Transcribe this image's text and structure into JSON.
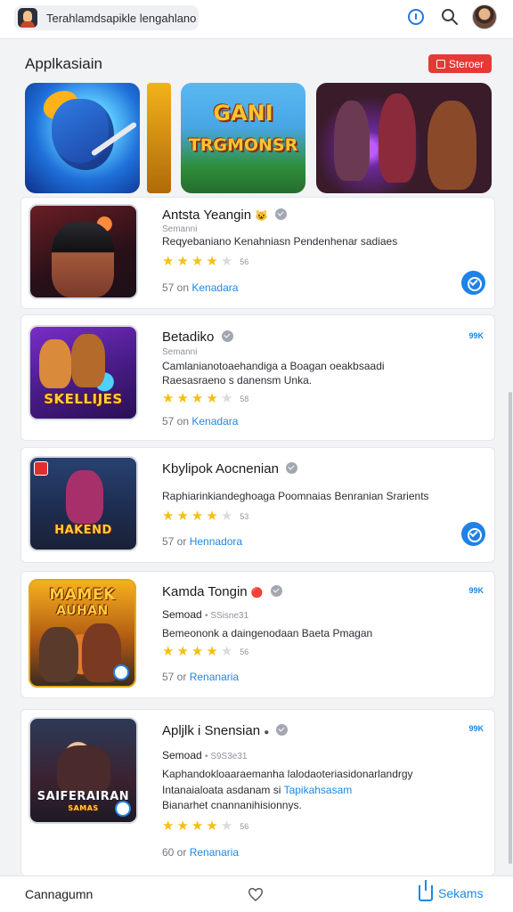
{
  "topbar": {
    "search_text": "Terahlamdsapikle lengahlano",
    "icons": [
      "app-icon",
      "info-icon",
      "search-icon",
      "avatar"
    ]
  },
  "section": {
    "title": "Applkasiain",
    "action_label": "Steroer",
    "accent": "#e53935"
  },
  "banners": [
    {
      "name": "banner-1",
      "title": ""
    },
    {
      "name": "banner-2",
      "title": ""
    },
    {
      "name": "banner-3",
      "title_line1": "GANI",
      "title_line2": "TRGMONSR"
    },
    {
      "name": "banner-4",
      "title": ""
    }
  ],
  "apps": [
    {
      "title": "Antsta Yeangin",
      "title_emoji": "😺",
      "subtitle": "Semanni",
      "desc_lines": [
        "Reqyebaniano Kenahniasn Pendenhenar sadiaes"
      ],
      "rating_stars": 4,
      "rating_text": "56",
      "meta": "57 on",
      "meta_link": "Kenadara",
      "count": "",
      "checked": true
    },
    {
      "title": "Betadiko",
      "title_emoji": "",
      "subtitle": "Semanni",
      "desc_lines": [
        "Camlanianotoaehandiga a Boagan oeakbsaadi",
        "Raesasraeno s danensm Unka."
      ],
      "rating_stars": 4,
      "rating_text": "58",
      "meta": "57 on",
      "meta_link": "Kenadara",
      "count": "99K",
      "checked": false,
      "thumb_label": "SKELLIJES"
    },
    {
      "title": "Kbylipok Aocnenian",
      "title_emoji": "",
      "subtitle": "",
      "desc_lines": [
        "Raphiarinkiandeghoaga Poomnaias Benranian Srarients"
      ],
      "rating_stars": 4,
      "rating_text": "53",
      "meta": "57 or",
      "meta_link": "Hennadora",
      "count": "",
      "checked": true,
      "thumb_label": "HAKEND"
    },
    {
      "title": "Kamda Tongin",
      "title_emoji": "🔴",
      "subtitle": "Semoad",
      "subtitle_extra": "• SSisne31",
      "desc_lines": [
        "Bemeononk a daingenodaan Baeta Pmagan"
      ],
      "rating_stars": 4,
      "rating_text": "56",
      "meta": "57 or",
      "meta_link": "Renanaria",
      "count": "99K",
      "checked": false,
      "thumb_label_top": "MAMEK",
      "thumb_label_bottom": "AUHAN"
    },
    {
      "title": "Apljlk i Snensian",
      "title_emoji": "●",
      "subtitle": "Semoad",
      "subtitle_extra": "• S9S3e31",
      "desc_lines": [
        "Kaphandokloaaraemanha lalodaoteriasidonarlandrgy",
        "Intanaialoata asdanam si",
        "Bianarhet cnannanihisionnys."
      ],
      "desc_link": "Tapikahsasam",
      "rating_stars": 4,
      "rating_text": "56",
      "meta": "60 or",
      "meta_link": "Renanaria",
      "count": "99K",
      "checked": false,
      "thumb_label": "SAIFERAIRAN",
      "thumb_sub": "SAMAS"
    }
  ],
  "bottom_nav": {
    "left_label": "Cannagumn",
    "right_label": "Sekams"
  }
}
